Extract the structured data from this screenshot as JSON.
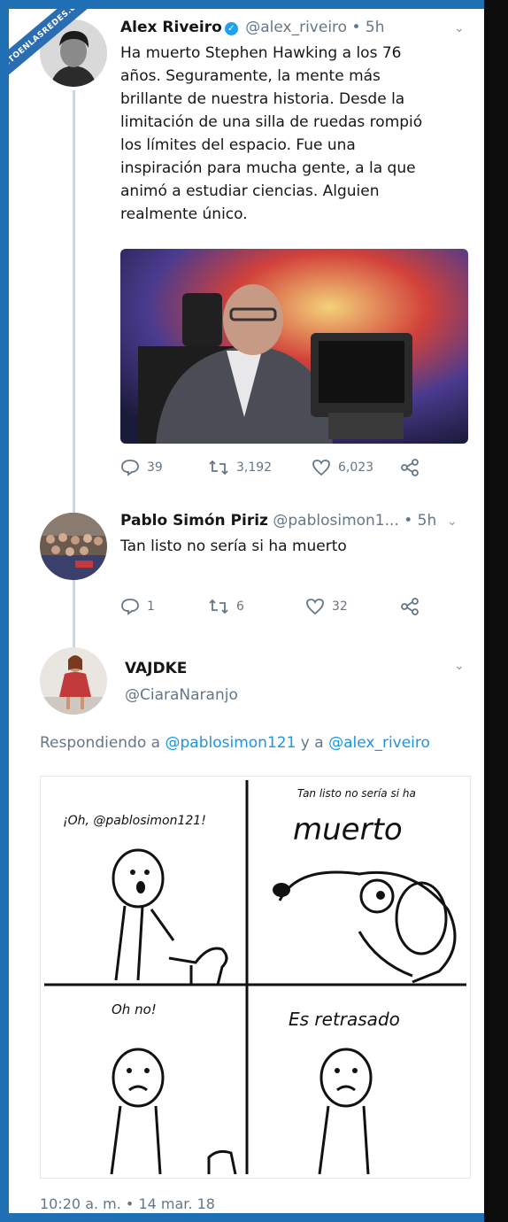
{
  "watermark": "VISTOENLASREDES.com",
  "tweet1": {
    "name": "Alex Riveiro",
    "handle": "@alex_riveiro",
    "time": "• 5h",
    "lines": [
      "Ha muerto Stephen Hawking a los 76",
      "años. Seguramente, la mente más",
      "brillante de nuestra historia. Desde la",
      "limitación de una silla de ruedas rompió",
      "los límites del espacio. Fue una",
      "inspiración para mucha gente, a la que",
      "animó a estudiar ciencias. Alguien",
      "realmente único."
    ],
    "replies": "39",
    "retweets": "3,192",
    "likes": "6,023"
  },
  "tweet2": {
    "name": "Pablo Simón Piriz",
    "handle": "@pablosimon1...",
    "time": "• 5h",
    "text": "Tan listo no sería si ha muerto",
    "replies": "1",
    "retweets": "6",
    "likes": "32"
  },
  "tweet3": {
    "name": "VAJDKE",
    "handle": "@CiaraNaranjo",
    "replying_prefix": "Respondiendo a",
    "replying_user1": "@pablosimon121",
    "replying_and": "y a",
    "replying_user2": "@alex_riveiro",
    "comic": {
      "panel1": "¡Oh, @pablosimon121!",
      "panel2_small": "Tan listo no sería si ha",
      "panel2_big": "muerto",
      "panel3": "Oh no!",
      "panel4": "Es retrasado"
    },
    "timestamp": "10:20 a. m. • 14 mar. 18"
  },
  "colors": {
    "link": "#1b95e0",
    "muted": "#657786",
    "frame": "#1f6fb5"
  }
}
